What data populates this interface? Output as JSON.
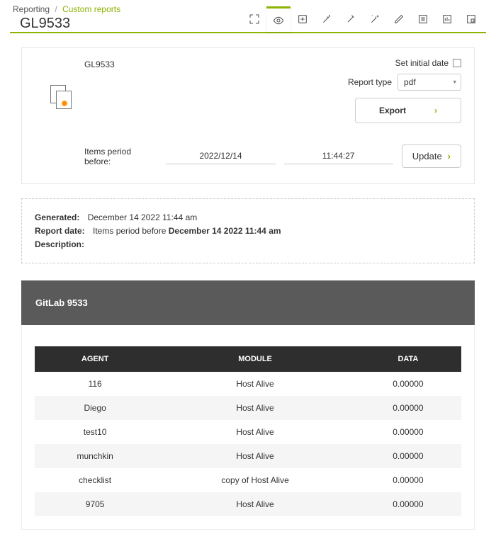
{
  "breadcrumb": {
    "root": "Reporting",
    "current": "Custom reports"
  },
  "page_title": "GL9533",
  "panel": {
    "report_name": "GL9533",
    "set_initial_label": "Set initial date",
    "report_type_label": "Report type",
    "report_type_value": "pdf",
    "export_label": "Export",
    "period_label": "Items period before:",
    "date_value": "2022/12/14",
    "time_value": "11:44:27",
    "update_label": "Update"
  },
  "meta": {
    "generated_label": "Generated:",
    "generated_value": "December 14 2022 11:44 am",
    "report_date_label": "Report date:",
    "report_date_prefix": "Items period before ",
    "report_date_value": "December 14 2022 11:44 am",
    "description_label": "Description:"
  },
  "section_title": "GitLab 9533",
  "table": {
    "headers": {
      "agent": "AGENT",
      "module": "MODULE",
      "data": "DATA"
    },
    "rows": [
      {
        "agent": "116",
        "module": "Host Alive",
        "data": "0.00000"
      },
      {
        "agent": "Diego",
        "module": "Host Alive",
        "data": "0.00000"
      },
      {
        "agent": "test10",
        "module": "Host Alive",
        "data": "0.00000"
      },
      {
        "agent": "munchkin",
        "module": "Host Alive",
        "data": "0.00000"
      },
      {
        "agent": "checklist",
        "module": "copy of Host Alive",
        "data": "0.00000"
      },
      {
        "agent": "9705",
        "module": "Host Alive",
        "data": "0.00000"
      }
    ]
  }
}
